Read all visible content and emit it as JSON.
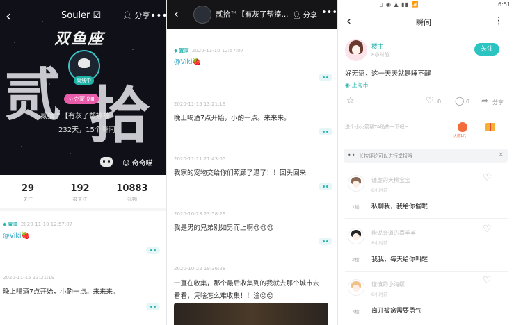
{
  "profile": {
    "back": "‹",
    "title": "Souler ☑",
    "share": "分享",
    "more": "•••",
    "calligraphy": "双鱼座",
    "big_chars": [
      "贰",
      "拾"
    ],
    "online_badge": "离线中",
    "pink_tag": "芬克蒙 ℣Ⅲ",
    "name_line": "贰拾™【有灰了帮擦擦",
    "days_line": "232天，15个瞬间",
    "own_world": "奇奇喵",
    "counts": [
      {
        "value": "29",
        "label": "关注"
      },
      {
        "value": "192",
        "label": "被关注"
      },
      {
        "value": "10883",
        "label": "礼物"
      }
    ],
    "posts": [
      {
        "pin": "置顶",
        "date": "2020-11-10 12:57:07",
        "mention": "@Viki",
        "emoji": "🍓"
      },
      {
        "date": "2020-11-15 13:21:19",
        "text": "晚上喝酒7点开始，小酌一点。来来来。"
      }
    ]
  },
  "detail": {
    "back": "‹",
    "title": "贰拾™【有灰了帮擦...",
    "share": "分享",
    "more": "•••",
    "posts": [
      {
        "pin": "置顶",
        "date": "2020-11-10 12:57:07",
        "mention": "@Viki",
        "emoji": "🍓"
      },
      {
        "date": "2020-11-15 13:21:19",
        "text": "晚上喝酒7点开始，小酌一点。来来来。"
      },
      {
        "date": "2020-11-11 21:43:05",
        "text": "我家的宠物交给你们照顾了退了！！回头回来"
      },
      {
        "date": "2020-10-23 23:58:29",
        "text": "我是男的兄弟别如男而上啊😢😢😢"
      },
      {
        "date": "2020-10-22 19:36:28",
        "text": "一直在收集，那个最后收集到的我就去那个城市去",
        "text2": "看看，凭啥怎么难收集！！淦😢😢"
      }
    ]
  },
  "moment": {
    "status_time": "6:51",
    "status_icons": "▯ ◉ ▲ ▮▮ 📶",
    "back": "‹",
    "title": "瞬间",
    "more": "⋮",
    "owner_name": "楼主",
    "owner_time": "8小时前",
    "follow": "关注",
    "post": "好无语，这一天天就是睡不醒",
    "location": "上海市",
    "actions": {
      "like": "0",
      "comment": "0",
      "share": "分享"
    },
    "gift_prompt": "送个小火箭帮TA助热一下吧~",
    "gift_label": "火箭1元",
    "tip": "长按评论可以进行举报哦~",
    "comments": [
      {
        "name": "谦虚的天桃宝宝",
        "time": "8小时前",
        "floor": "1楼",
        "text": "私聊我，我给你催眠"
      },
      {
        "name": "能说会道的喜羊羊",
        "time": "8小时前",
        "floor": "2楼",
        "text": "我我，每天给你叫醒"
      },
      {
        "name": "谨慎的小海螺",
        "time": "8小时前",
        "floor": "3楼",
        "text": "离开被窝需要勇气"
      }
    ]
  }
}
